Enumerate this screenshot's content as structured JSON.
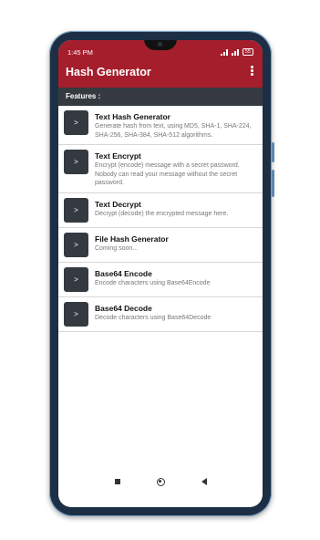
{
  "status_bar": {
    "time": "1:45 PM",
    "battery": "55"
  },
  "app_bar": {
    "title": "Hash Generator"
  },
  "section": {
    "label": "Features :"
  },
  "features": [
    {
      "badge": ">",
      "title": "Text Hash Generator",
      "description": "Generate hash from text, using MD5, SHA-1, SHA-224, SHA-256, SHA-384, SHA-512 algorithms."
    },
    {
      "badge": ">",
      "title": "Text Encrypt",
      "description": "Encrypt (encode) message with a secret password. Nobody can read your message without the secret password."
    },
    {
      "badge": ">",
      "title": "Text Decrypt",
      "description": "Decrypt (decode) the encrypted message here."
    },
    {
      "badge": ">",
      "title": "File Hash Generator",
      "description": "Coming soon..."
    },
    {
      "badge": ">",
      "title": "Base64 Encode",
      "description": "Encode characters using Base64Encode"
    },
    {
      "badge": ">",
      "title": "Base64 Decode",
      "description": "Decode characters using Base64Decode"
    }
  ],
  "colors": {
    "app_bar": "#a51e2c",
    "section_header": "#343a40",
    "badge": "#343a40"
  }
}
